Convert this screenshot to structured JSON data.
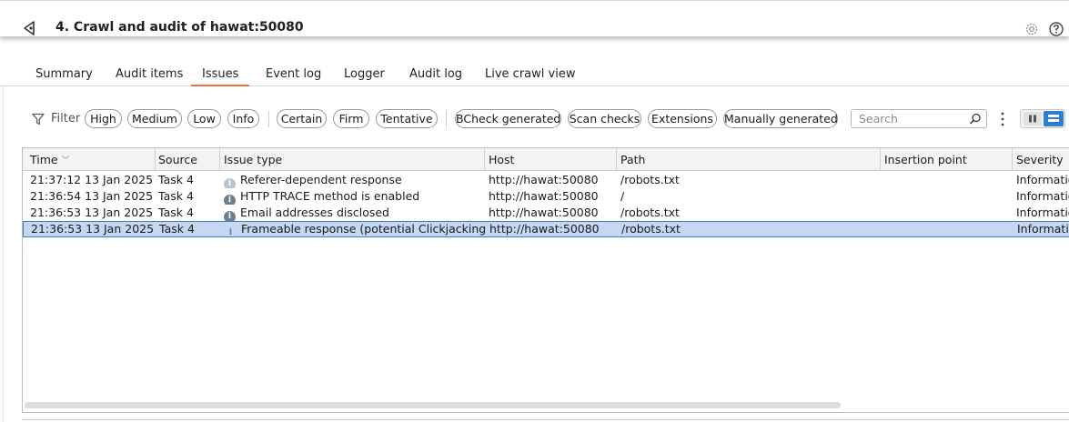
{
  "header": {
    "title": "4. Crawl and audit of hawat:50080",
    "back_icon": "back-arrow-icon",
    "settings_icon": "gear-icon",
    "help_icon": "help-icon"
  },
  "tabs": [
    {
      "label": "Summary",
      "active": false
    },
    {
      "label": "Audit items",
      "active": false
    },
    {
      "label": "Issues",
      "active": true
    },
    {
      "label": "Event log",
      "active": false
    },
    {
      "label": "Logger",
      "active": false
    },
    {
      "label": "Audit log",
      "active": false
    },
    {
      "label": "Live crawl view",
      "active": false
    }
  ],
  "filter": {
    "label": "Filter",
    "severity": [
      "High",
      "Medium",
      "Low",
      "Info"
    ],
    "confidence": [
      "Certain",
      "Firm",
      "Tentative"
    ],
    "source": [
      "BCheck generated",
      "Scan checks",
      "Extensions",
      "Manually generated"
    ],
    "search_placeholder": "Search"
  },
  "colors": {
    "accent": "#e8743b",
    "selection": "#c5d8f1",
    "toggle_active": "#2a7fd1"
  },
  "table": {
    "columns": [
      "Time",
      "Source",
      "Issue type",
      "Host",
      "Path",
      "Insertion point",
      "Severity"
    ],
    "rows": [
      {
        "time": "21:37:12 13 Jan 2025",
        "source": "Task 4",
        "issue": "Referer-dependent response",
        "host": "http://hawat:50080",
        "path": "/robots.txt",
        "insertion": "",
        "severity": "Information"
      },
      {
        "time": "21:36:54 13 Jan 2025",
        "source": "Task 4",
        "issue": "HTTP TRACE method is enabled",
        "host": "http://hawat:50080",
        "path": "/",
        "insertion": "",
        "severity": "Information"
      },
      {
        "time": "21:36:53 13 Jan 2025",
        "source": "Task 4",
        "issue": "Email addresses disclosed",
        "host": "http://hawat:50080",
        "path": "/robots.txt",
        "insertion": "",
        "severity": "Information"
      },
      {
        "time": "21:36:53 13 Jan 2025",
        "source": "Task 4",
        "issue": "Frameable response (potential Clickjacking)",
        "host": "http://hawat:50080",
        "path": "/robots.txt",
        "insertion": "",
        "severity": "Information"
      }
    ],
    "selected_row": 3
  }
}
